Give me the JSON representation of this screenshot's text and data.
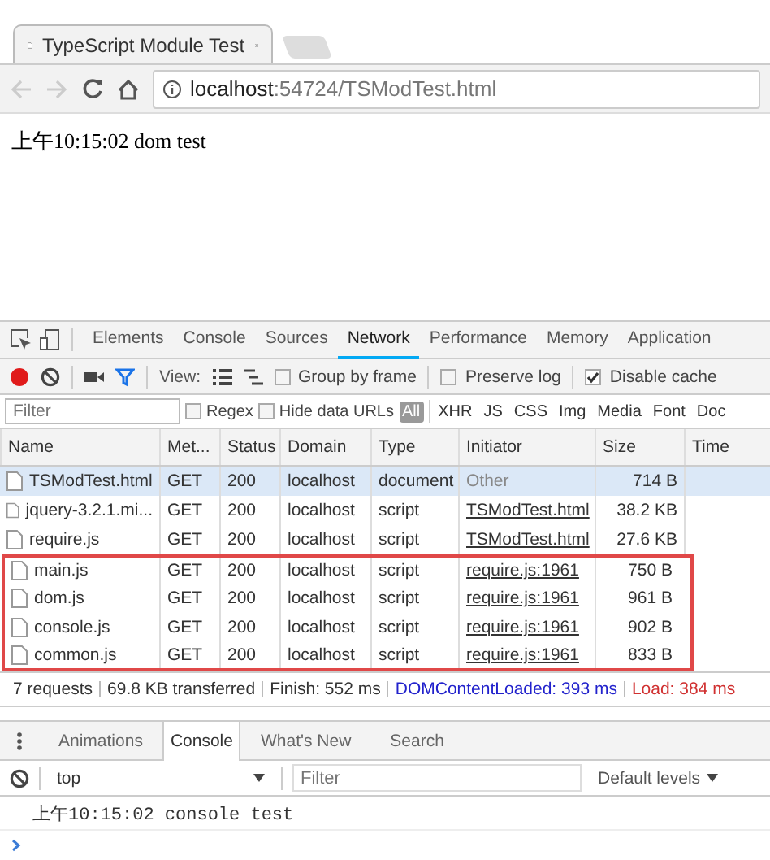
{
  "browser": {
    "tab_title": "TypeScript Module Test",
    "address_host": "localhost",
    "address_rest": ":54724/TSModTest.html"
  },
  "page": {
    "text": "上午10:15:02 dom test"
  },
  "devtools": {
    "tabs": [
      {
        "label": "Elements",
        "selected": false
      },
      {
        "label": "Console",
        "selected": false
      },
      {
        "label": "Sources",
        "selected": false
      },
      {
        "label": "Network",
        "selected": true
      },
      {
        "label": "Performance",
        "selected": false
      },
      {
        "label": "Memory",
        "selected": false
      },
      {
        "label": "Application",
        "selected": false
      }
    ],
    "toolbar": {
      "recording": true,
      "view_label": "View:",
      "checkboxes": [
        {
          "label": "Group by frame",
          "checked": false
        },
        {
          "label": "Preserve log",
          "checked": false
        },
        {
          "label": "Disable cache",
          "checked": true
        }
      ]
    },
    "filter": {
      "placeholder": "Filter",
      "options": [
        {
          "label": "Regex",
          "checked": false
        },
        {
          "label": "Hide data URLs",
          "checked": false
        }
      ],
      "types": [
        {
          "label": "All",
          "selected": true
        },
        {
          "label": "XHR",
          "selected": false
        },
        {
          "label": "JS",
          "selected": false
        },
        {
          "label": "CSS",
          "selected": false
        },
        {
          "label": "Img",
          "selected": false
        },
        {
          "label": "Media",
          "selected": false
        },
        {
          "label": "Font",
          "selected": false
        },
        {
          "label": "Doc",
          "selected": false
        }
      ]
    },
    "table": {
      "columns": [
        "Name",
        "Met...",
        "Status",
        "Domain",
        "Type",
        "Initiator",
        "Size",
        "Time"
      ],
      "rows": [
        {
          "name": "TSModTest.html",
          "method": "GET",
          "status": "200",
          "domain": "localhost",
          "type": "document",
          "initiator": "Other",
          "initiator_link": false,
          "size": "714 B",
          "selected": true,
          "highlighted": false
        },
        {
          "name": "jquery-3.2.1.mi...",
          "method": "GET",
          "status": "200",
          "domain": "localhost",
          "type": "script",
          "initiator": "TSModTest.html",
          "initiator_link": true,
          "size": "38.2 KB",
          "selected": false,
          "highlighted": false
        },
        {
          "name": "require.js",
          "method": "GET",
          "status": "200",
          "domain": "localhost",
          "type": "script",
          "initiator": "TSModTest.html",
          "initiator_link": true,
          "size": "27.6 KB",
          "selected": false,
          "highlighted": false
        },
        {
          "name": "main.js",
          "method": "GET",
          "status": "200",
          "domain": "localhost",
          "type": "script",
          "initiator": "require.js:1961",
          "initiator_link": true,
          "size": "750 B",
          "selected": false,
          "highlighted": true
        },
        {
          "name": "dom.js",
          "method": "GET",
          "status": "200",
          "domain": "localhost",
          "type": "script",
          "initiator": "require.js:1961",
          "initiator_link": true,
          "size": "961 B",
          "selected": false,
          "highlighted": true
        },
        {
          "name": "console.js",
          "method": "GET",
          "status": "200",
          "domain": "localhost",
          "type": "script",
          "initiator": "require.js:1961",
          "initiator_link": true,
          "size": "902 B",
          "selected": false,
          "highlighted": true
        },
        {
          "name": "common.js",
          "method": "GET",
          "status": "200",
          "domain": "localhost",
          "type": "script",
          "initiator": "require.js:1961",
          "initiator_link": true,
          "size": "833 B",
          "selected": false,
          "highlighted": true
        }
      ]
    },
    "status_bar": [
      {
        "text": "7 requests",
        "kind": "plain"
      },
      {
        "text": "69.8 KB transferred",
        "kind": "plain"
      },
      {
        "text": "Finish: 552 ms",
        "kind": "plain"
      },
      {
        "text": "DOMContentLoaded: 393 ms",
        "kind": "dom"
      },
      {
        "text": "Load: 384 ms",
        "kind": "load"
      }
    ]
  },
  "drawer": {
    "tabs": [
      {
        "label": "Animations",
        "selected": false
      },
      {
        "label": "Console",
        "selected": true
      },
      {
        "label": "What's New",
        "selected": false
      },
      {
        "label": "Search",
        "selected": false
      }
    ],
    "context": "top",
    "filter_placeholder": "Filter",
    "levels": "Default levels",
    "log": [
      "上午10:15:02 console test"
    ]
  }
}
